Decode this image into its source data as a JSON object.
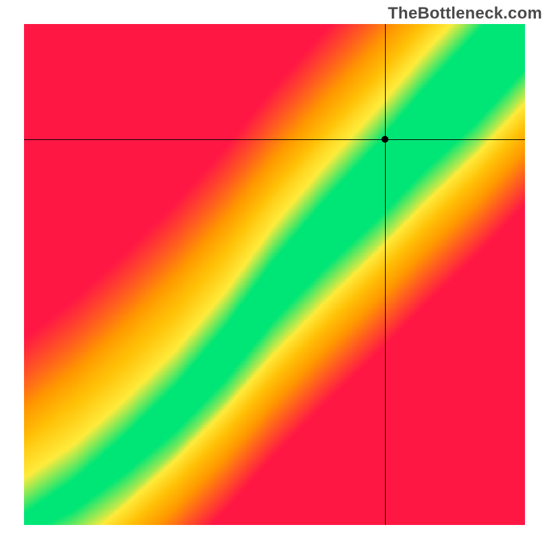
{
  "watermark": "TheBottleneck.com",
  "chart_data": {
    "type": "heatmap",
    "title": "",
    "xlabel": "",
    "ylabel": "",
    "xlim": [
      0,
      1
    ],
    "ylim": [
      0,
      1
    ],
    "grid": false,
    "legend": false,
    "annotations": [],
    "marker": {
      "x": 0.72,
      "y": 0.77
    },
    "crosshair": {
      "x": 0.72,
      "y": 0.77
    },
    "ridge_points": [
      {
        "x": 0.0,
        "y": 0.0
      },
      {
        "x": 0.1,
        "y": 0.06
      },
      {
        "x": 0.2,
        "y": 0.14
      },
      {
        "x": 0.3,
        "y": 0.23
      },
      {
        "x": 0.4,
        "y": 0.34
      },
      {
        "x": 0.5,
        "y": 0.47
      },
      {
        "x": 0.6,
        "y": 0.58
      },
      {
        "x": 0.7,
        "y": 0.68
      },
      {
        "x": 0.8,
        "y": 0.79
      },
      {
        "x": 0.9,
        "y": 0.89
      },
      {
        "x": 1.0,
        "y": 1.0
      }
    ],
    "ridge_halfwidth": 0.045,
    "color_stops": [
      {
        "t": 0.0,
        "color": "#ff1744"
      },
      {
        "t": 0.2,
        "color": "#ff5722"
      },
      {
        "t": 0.4,
        "color": "#ff9800"
      },
      {
        "t": 0.6,
        "color": "#ffc107"
      },
      {
        "t": 0.8,
        "color": "#ffeb3b"
      },
      {
        "t": 1.0,
        "color": "#00e676"
      }
    ],
    "resolution": 220
  }
}
